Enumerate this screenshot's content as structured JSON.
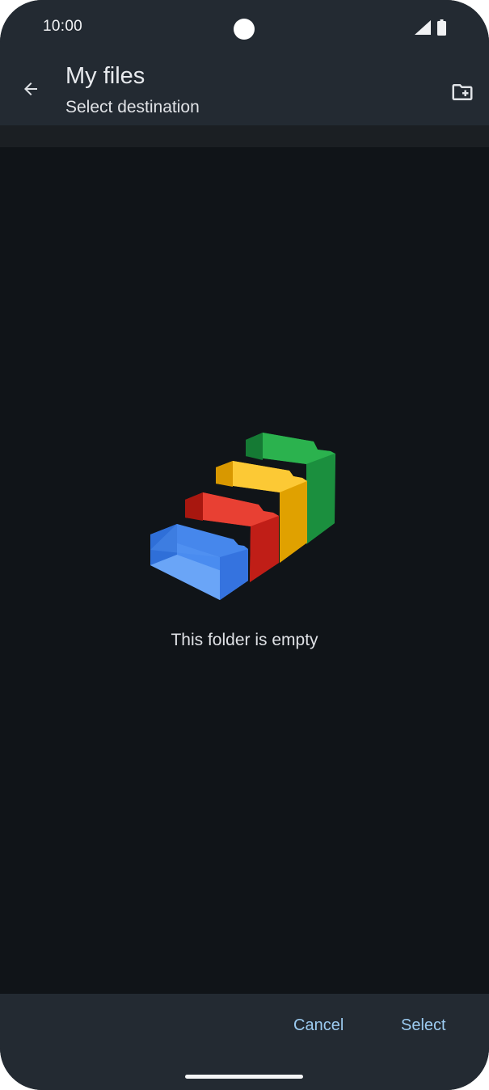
{
  "status_bar": {
    "time": "10:00",
    "icons": [
      "signal-icon",
      "battery-icon"
    ]
  },
  "app_bar": {
    "title": "My files",
    "subtitle": "Select destination",
    "back_icon": "arrow-back-icon",
    "new_folder_icon": "create-new-folder-icon"
  },
  "empty_state": {
    "message": "This folder is empty",
    "illustration_colors": [
      "#4285f4",
      "#ea4335",
      "#fbbc04",
      "#34a853"
    ]
  },
  "actions": {
    "cancel_label": "Cancel",
    "select_label": "Select"
  },
  "theme": {
    "background": "#101418",
    "surface": "#232a32",
    "accent": "#9ccbf0"
  }
}
